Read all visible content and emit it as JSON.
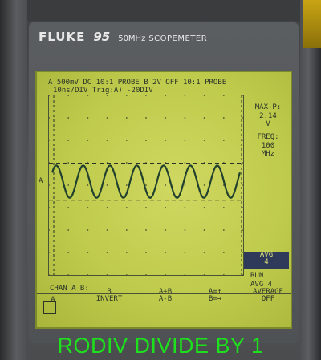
{
  "device": {
    "brand": "FLUKE",
    "model": "95",
    "bandwidth": "50MHz",
    "type": "SCOPEMETER"
  },
  "screen": {
    "header_line1": "A 500mV DC  10:1 PROBE B  2V OFF 10:1 PROBE",
    "header_line2": "10ns/DIV        Trig:A) -20DIV",
    "channel_marker": "A",
    "readings": {
      "max_p_label": "MAX-P:",
      "max_p_value": "2.14",
      "max_p_unit": "V",
      "freq_label": "FREQ:",
      "freq_value": "100",
      "freq_unit": "MHz"
    },
    "menu": {
      "avg_selected_line1": "AVG",
      "avg_selected_line2": "4",
      "run_line1": "RUN",
      "run_line2": "AVG 4"
    },
    "chan_label": "CHAN A B:",
    "softkeys": [
      {
        "line1": "A",
        "line2": ""
      },
      {
        "line1": "B",
        "line2": "INVERT"
      },
      {
        "line1": "A+B",
        "line2": "A-B"
      },
      {
        "line1": "A=↑",
        "line2": "B=→"
      },
      {
        "line1": "AVERAGE",
        "line2": "OFF"
      }
    ],
    "waveform": {
      "cycles": 7,
      "amplitude_div": 0.6,
      "offset_div": 0.2
    }
  },
  "caption": "RODIV DIVIDE BY 1",
  "colors": {
    "lcd": "#c8d257",
    "ink": "#2b3329",
    "caption": "#1de11d",
    "selection": "#2f3a5a"
  }
}
